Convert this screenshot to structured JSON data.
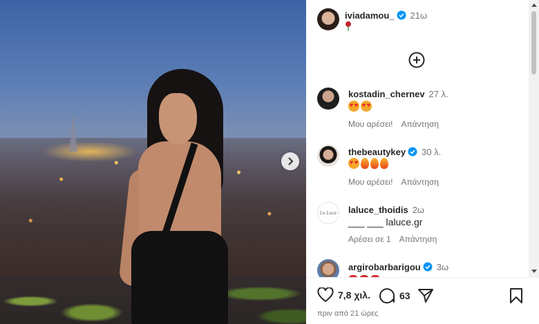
{
  "post": {
    "author": "iviadamou_",
    "time": "21ω"
  },
  "comments": [
    {
      "username": "kostadin_chernev",
      "time": "27 λ.",
      "like_label": "Μου αρέσει!",
      "reply_label": "Απάντηση"
    },
    {
      "username": "thebeautykey",
      "time": "30 λ.",
      "like_label": "Μου αρέσει!",
      "reply_label": "Απάντηση"
    },
    {
      "username": "laluce_thoidis",
      "time": "2ω",
      "text": "___ ___ laluce.gr",
      "like_label": "Αρέσει σε 1",
      "reply_label": "Απάντηση",
      "avatar_text": "Lu Luce"
    },
    {
      "username": "argirobarbarigou",
      "time": "3ω"
    }
  ],
  "footer": {
    "likes": "7,8 χιλ.",
    "comments": "63",
    "posted_ago": "πριν από 21 ώρες"
  },
  "colors": {
    "verified": "#0095f6",
    "text": "#262626",
    "secondary": "#737373"
  },
  "icons": [
    "verified-badge-icon",
    "rose-emoji-icon",
    "add-circle-icon",
    "heart-eyes-emoji-icon",
    "fire-emoji-icon",
    "heart-emoji-icon",
    "heart-icon",
    "comment-icon",
    "share-icon",
    "bookmark-icon",
    "chevron-right-icon"
  ]
}
